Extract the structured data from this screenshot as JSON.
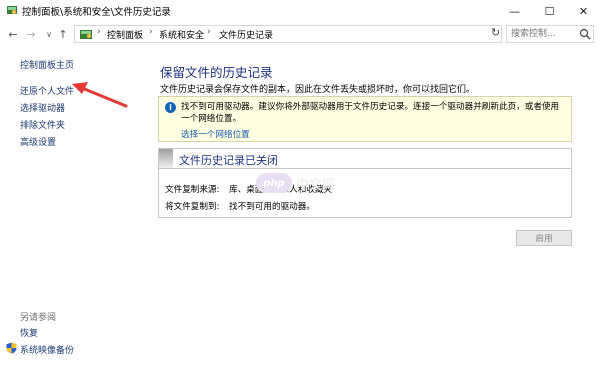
{
  "window": {
    "title": "控制面板\\系统和安全\\文件历史记录",
    "minimize_glyph": "—",
    "maximize_glyph": "☐",
    "close_glyph": "✕"
  },
  "address_bar": {
    "back_glyph": "←",
    "forward_glyph": "→",
    "history_glyph": "∨",
    "up_glyph": "↑",
    "crumb_sep": "›",
    "breadcrumbs": [
      "控制面板",
      "系统和安全",
      "文件历史记录"
    ],
    "dropdown_glyph": "∨",
    "refresh_glyph": "↻",
    "search_placeholder": "搜索控制...",
    "search_icon": "search-icon"
  },
  "left_nav": {
    "home": "控制面板主页",
    "items": [
      "还原个人文件",
      "选择驱动器",
      "排除文件夹",
      "高级设置"
    ],
    "see_also_label": "另请参阅",
    "see_also_items": [
      "恢复",
      "系统映像备份"
    ]
  },
  "main": {
    "title": "保留文件的历史记录",
    "description": "文件历史记录会保存文件的副本，因此在文件丢失或损坏时，你可以找回它们。",
    "warning": {
      "icon_glyph": "i",
      "text": "找不到可用驱动器。建议你将外部驱动器用于文件历史记录。连接一个驱动器并刷新此页，或者使用一个网络位置。",
      "link": "选择一个网络位置"
    },
    "status_panel": {
      "title": "文件历史记录已关闭",
      "copy_from_label": "文件复制来源:",
      "copy_from_value": "库、桌面、联系人和收藏夹",
      "copy_to_label": "将文件复制到:",
      "copy_to_value": "找不到可用的驱动器。"
    },
    "enable_button": "启用"
  },
  "watermark": {
    "badge": "php",
    "text": "中文网"
  },
  "colors": {
    "title_blue": "#1e3287",
    "link_blue": "#1f5fb0",
    "nav_link": "#1c3a73",
    "warning_bg": "#ffffe1",
    "annotation_red": "#e53935"
  }
}
